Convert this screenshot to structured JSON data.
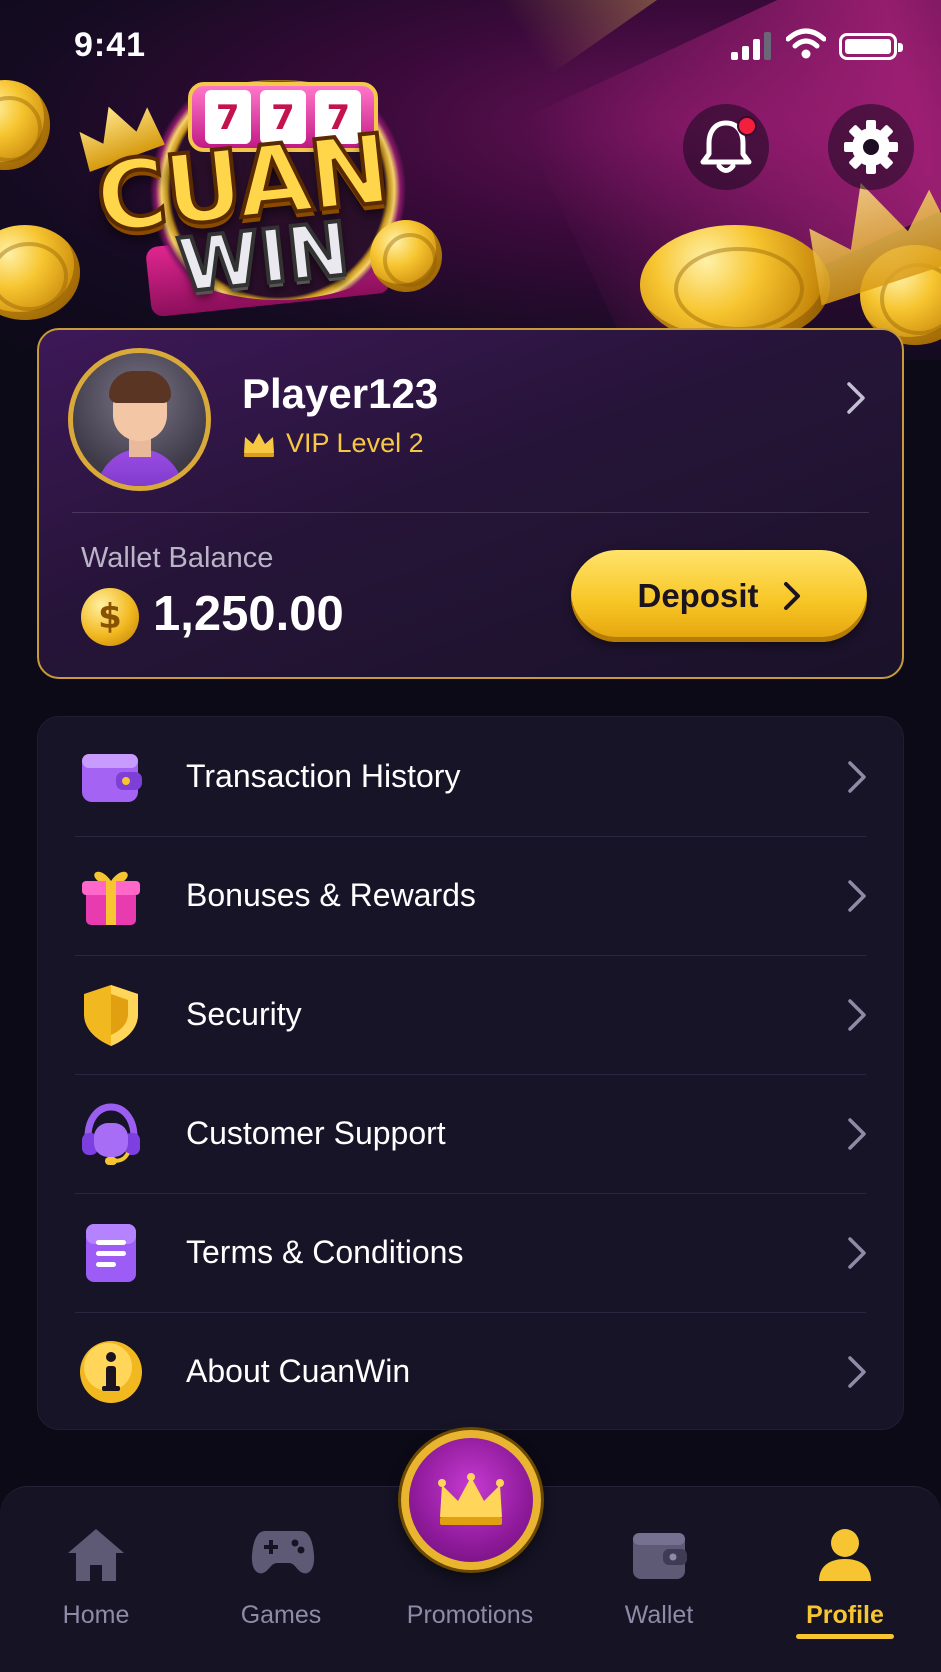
{
  "status_bar": {
    "time": "9:41"
  },
  "header": {
    "logo_reels": [
      "7",
      "7",
      "7"
    ],
    "logo_line1": "CUAN",
    "logo_line2": "WIN",
    "has_notification": true
  },
  "profile": {
    "username": "Player123",
    "vip_label": "VIP Level 2",
    "wallet_label": "Wallet Balance",
    "wallet_amount": "1,250.00",
    "currency_symbol": "$",
    "deposit_label": "Deposit"
  },
  "menu": {
    "items": [
      {
        "label": "Transaction History",
        "icon": "wallet-icon"
      },
      {
        "label": "Bonuses & Rewards",
        "icon": "gift-icon"
      },
      {
        "label": "Security",
        "icon": "shield-icon"
      },
      {
        "label": "Customer Support",
        "icon": "headset-icon"
      },
      {
        "label": "Terms & Conditions",
        "icon": "document-icon"
      },
      {
        "label": "About CuanWin",
        "icon": "info-icon"
      }
    ]
  },
  "bottom_nav": {
    "items": [
      {
        "label": "Home",
        "icon": "home-icon"
      },
      {
        "label": "Games",
        "icon": "gamepad-icon"
      },
      {
        "label": "Promotions",
        "icon": "crown-icon"
      },
      {
        "label": "Wallet",
        "icon": "wallet-icon"
      },
      {
        "label": "Profile",
        "icon": "user-icon"
      }
    ],
    "active": "Profile"
  },
  "colors": {
    "background": "#0c0a17",
    "accent_gold": "#f6c531",
    "accent_purple": "#8e1a9a",
    "card_border": "#c79b3c",
    "notification": "#f2203c"
  }
}
